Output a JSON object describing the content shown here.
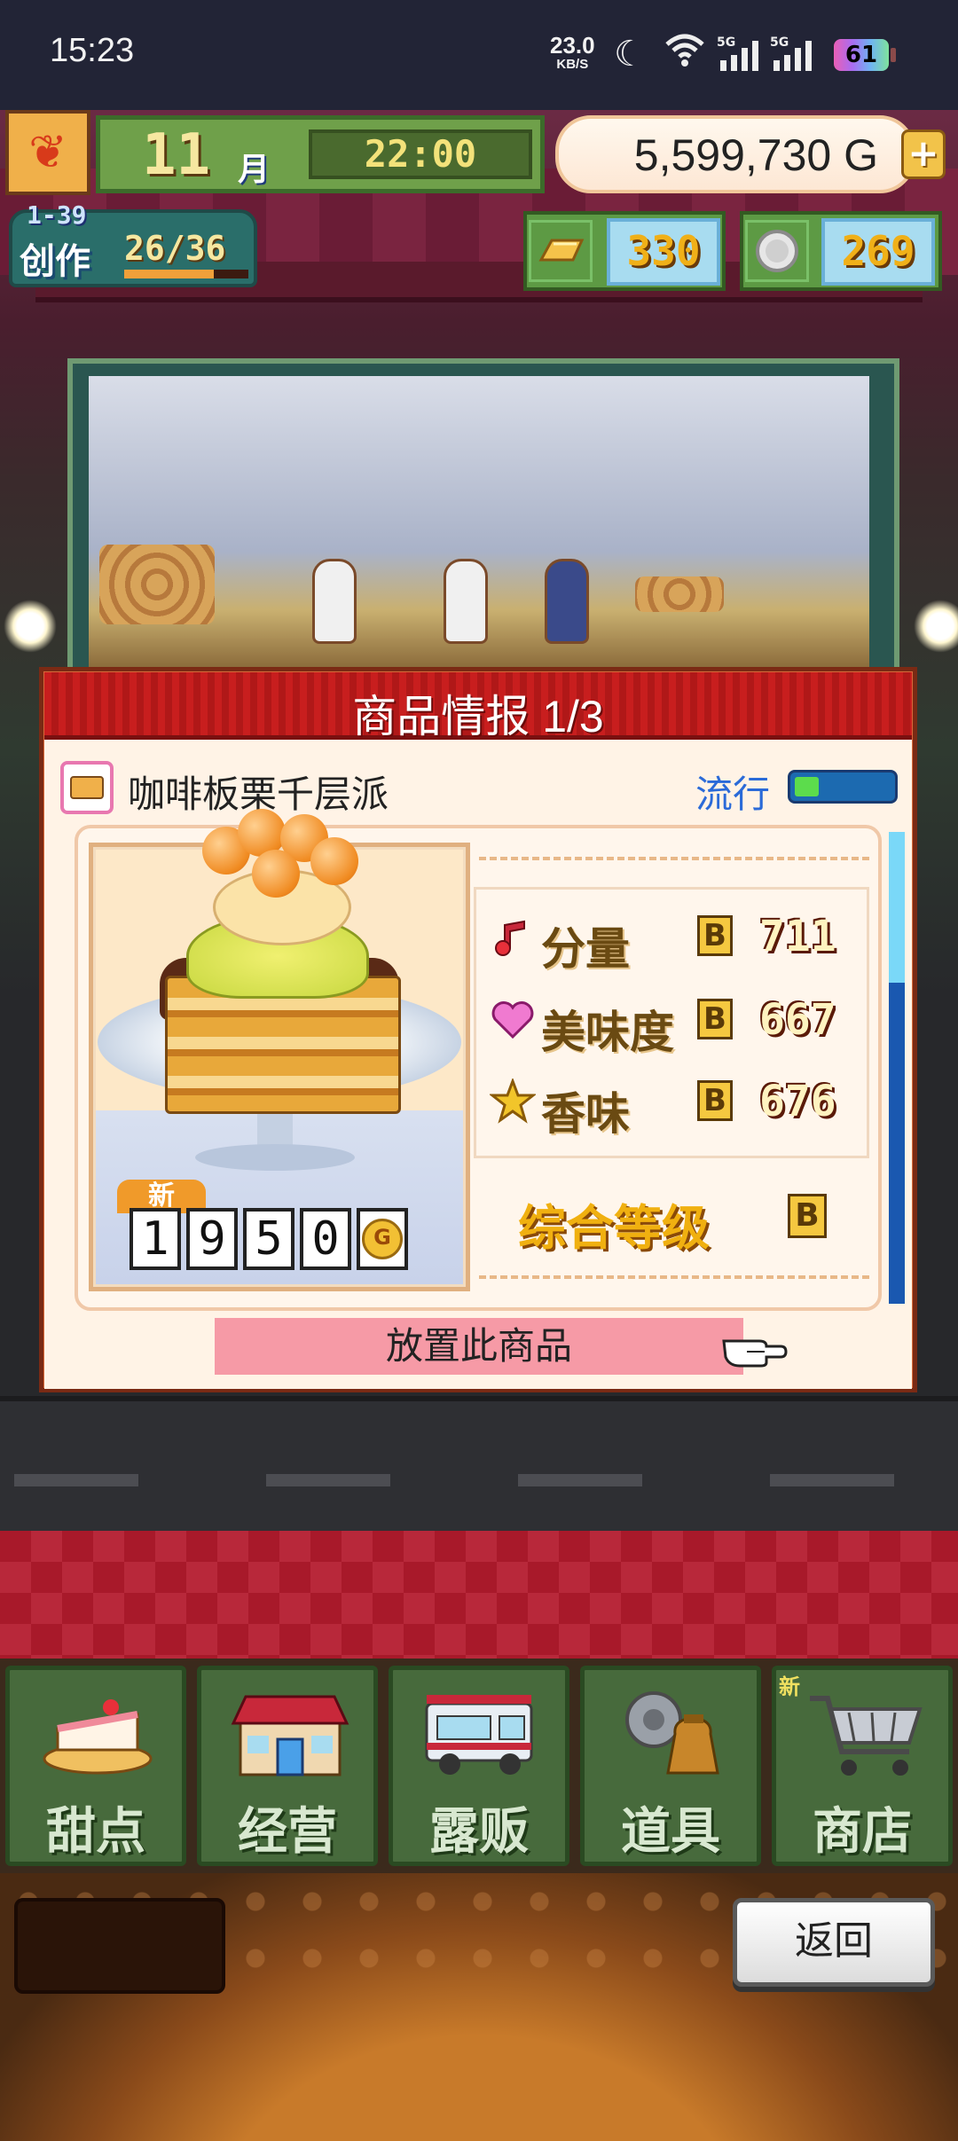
{
  "status_bar": {
    "time": "15:23",
    "net_speed": "23.0",
    "net_unit": "KB/S",
    "signal_1": "5G",
    "signal_2": "5G",
    "battery": "61"
  },
  "hud": {
    "month": "11",
    "month_label": "月",
    "clock": "22:00",
    "gold": "5,599,730 G",
    "create_label": "创作",
    "create_level": "1-39",
    "create_count": "26/36",
    "create_progress": 0.72,
    "gold_bars": "330",
    "silver_coins": "269"
  },
  "dialog": {
    "title": "商品情报 1/3",
    "product_name": "咖啡板栗千层派",
    "trend_label": "流行",
    "trend_level": 0.25,
    "new_badge": "新",
    "price_digits": [
      "1",
      "9",
      "5",
      "0"
    ],
    "price_unit_icon": "G",
    "stats": [
      {
        "icon": "music-note-icon",
        "label": "分量",
        "grade": "B",
        "value": "711"
      },
      {
        "icon": "heart-icon",
        "label": "美味度",
        "grade": "B",
        "value": "667"
      },
      {
        "icon": "star-icon",
        "label": "香味",
        "grade": "B",
        "value": "676"
      }
    ],
    "overall_label": "综合等级",
    "overall_grade": "B",
    "place_button": "放置此商品"
  },
  "menu": [
    {
      "label": "甜点",
      "icon": "cake-icon"
    },
    {
      "label": "经营",
      "icon": "shop-icon"
    },
    {
      "label": "露贩",
      "icon": "food-truck-icon"
    },
    {
      "label": "道具",
      "icon": "items-icon"
    },
    {
      "label": "商店",
      "icon": "cart-icon",
      "badge": "新"
    }
  ],
  "back_button": "返回",
  "colors": {
    "dialog_header": "#c81e1e",
    "trend_fill": "#5cdc4c",
    "place_button": "#f69aa6",
    "menu_button": "#476a3c"
  }
}
